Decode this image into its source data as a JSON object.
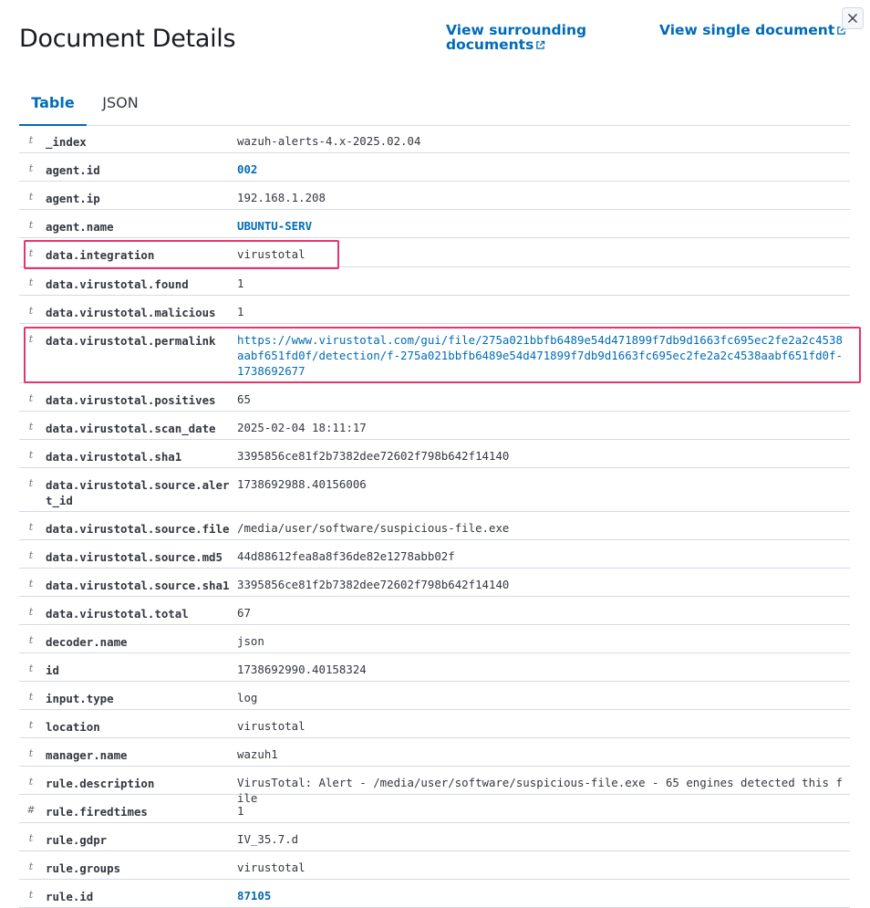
{
  "title": "Document Details",
  "links": {
    "surrounding": "View surrounding documents",
    "single": "View single document"
  },
  "tabs": [
    {
      "label": "Table",
      "active": true
    },
    {
      "label": "JSON",
      "active": false
    }
  ],
  "colors": {
    "accent": "#006bb8",
    "highlight": "#e7336d",
    "border": "#d3dae6"
  },
  "rows": [
    {
      "type": "t",
      "field": "_index",
      "value": "wazuh-alerts-4.x-2025.02.04"
    },
    {
      "type": "t",
      "field": "agent.id",
      "value": "002",
      "style": "link"
    },
    {
      "type": "t",
      "field": "agent.ip",
      "value": "192.168.1.208"
    },
    {
      "type": "t",
      "field": "agent.name",
      "value": "UBUNTU-SERV",
      "style": "link"
    },
    {
      "type": "t",
      "field": "data.integration",
      "value": "virustotal",
      "highlighted": true
    },
    {
      "type": "t",
      "field": "data.virustotal.found",
      "value": "1"
    },
    {
      "type": "t",
      "field": "data.virustotal.malicious",
      "value": "1"
    },
    {
      "type": "t",
      "field": "data.virustotal.permalink",
      "value": "https://www.virustotal.com/gui/file/275a021bbfb6489e54d471899f7db9d1663fc695ec2fe2a2c4538aabf651fd0f/detection/f-275a021bbfb6489e54d471899f7db9d1663fc695ec2fe2a2c4538aabf651fd0f-1738692677",
      "style": "url",
      "highlighted": true
    },
    {
      "type": "t",
      "field": "data.virustotal.positives",
      "value": "65"
    },
    {
      "type": "t",
      "field": "data.virustotal.scan_date",
      "value": "2025-02-04 18:11:17"
    },
    {
      "type": "t",
      "field": "data.virustotal.sha1",
      "value": "3395856ce81f2b7382dee72602f798b642f14140"
    },
    {
      "type": "t",
      "field": "data.virustotal.source.alert_id",
      "value": "1738692988.40156006"
    },
    {
      "type": "t",
      "field": "data.virustotal.source.file",
      "value": "/media/user/software/suspicious-file.exe"
    },
    {
      "type": "t",
      "field": "data.virustotal.source.md5",
      "value": "44d88612fea8a8f36de82e1278abb02f"
    },
    {
      "type": "t",
      "field": "data.virustotal.source.sha1",
      "value": "3395856ce81f2b7382dee72602f798b642f14140"
    },
    {
      "type": "t",
      "field": "data.virustotal.total",
      "value": "67"
    },
    {
      "type": "t",
      "field": "decoder.name",
      "value": "json"
    },
    {
      "type": "t",
      "field": "id",
      "value": "1738692990.40158324"
    },
    {
      "type": "t",
      "field": "input.type",
      "value": "log"
    },
    {
      "type": "t",
      "field": "location",
      "value": "virustotal"
    },
    {
      "type": "t",
      "field": "manager.name",
      "value": "wazuh1"
    },
    {
      "type": "t",
      "field": "rule.description",
      "value": "VirusTotal: Alert - /media/user/software/suspicious-file.exe - 65 engines detected this file"
    },
    {
      "type": "#",
      "field": "rule.firedtimes",
      "value": "1"
    },
    {
      "type": "t",
      "field": "rule.gdpr",
      "value": "IV_35.7.d"
    },
    {
      "type": "t",
      "field": "rule.groups",
      "value": "virustotal"
    },
    {
      "type": "t",
      "field": "rule.id",
      "value": "87105",
      "style": "link"
    }
  ]
}
